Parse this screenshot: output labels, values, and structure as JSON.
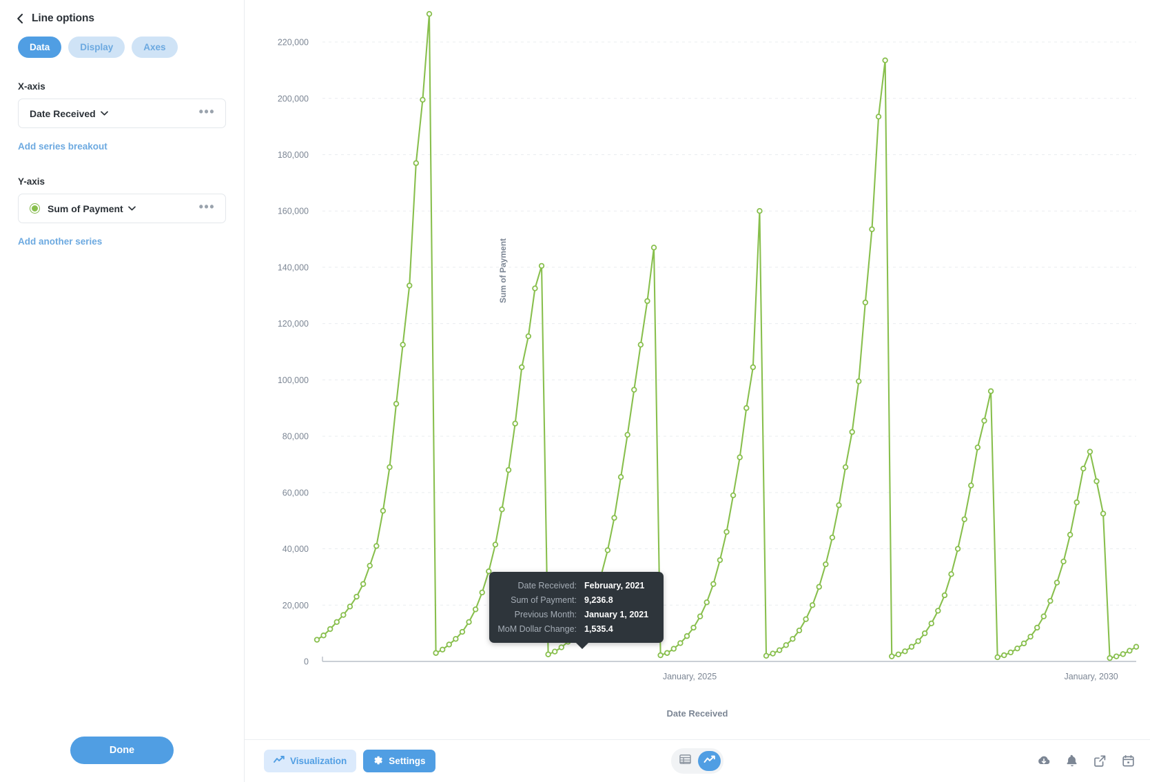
{
  "sidebar": {
    "back_icon": "chevron-left-icon",
    "title": "Line options",
    "tabs": [
      {
        "label": "Data",
        "active": true
      },
      {
        "label": "Display",
        "active": false
      },
      {
        "label": "Axes",
        "active": false
      }
    ],
    "x_axis": {
      "label": "X-axis",
      "value": "Date Received",
      "more_icon": "ellipsis-icon"
    },
    "add_series_breakout": "Add series breakout",
    "y_axis": {
      "label": "Y-axis",
      "value": "Sum of Payment",
      "series_color": "#88bf4d",
      "more_icon": "ellipsis-icon"
    },
    "add_another_series": "Add another series",
    "done_label": "Done"
  },
  "footer": {
    "visualization_label": "Visualization",
    "visualization_icon": "line-chart-icon",
    "settings_label": "Settings",
    "settings_icon": "gear-icon",
    "table_toggle_icon": "table-icon",
    "chart_toggle_icon": "line-chart-icon",
    "right_icons": [
      "download-icon",
      "bell-icon",
      "share-external-icon",
      "calendar-icon"
    ]
  },
  "tooltip": {
    "rows": [
      {
        "key": "Date Received:",
        "value": "February, 2021"
      },
      {
        "key": "Sum of Payment:",
        "value": "9,236.8"
      },
      {
        "key": "Previous Month:",
        "value": "January 1, 2021"
      },
      {
        "key": "MoM Dollar Change:",
        "value": "1,535.4"
      }
    ]
  },
  "chart_data": {
    "type": "line",
    "title": "",
    "xlabel": "Date Received",
    "ylabel": "Sum of Payment",
    "ylim": [
      0,
      232000
    ],
    "yticks": [
      0,
      20000,
      40000,
      60000,
      80000,
      100000,
      120000,
      140000,
      160000,
      180000,
      200000,
      220000
    ],
    "ytick_labels": [
      "0",
      "20,000",
      "40,000",
      "60,000",
      "80,000",
      "100,000",
      "120,000",
      "140,000",
      "160,000",
      "180,000",
      "200,000",
      "220,000"
    ],
    "xticks": [
      "January, 2025",
      "January, 2030"
    ],
    "xtick_positions": [
      0.455,
      0.945
    ],
    "grid": true,
    "legend": "none",
    "line_color": "#88bf4d",
    "marker": "circle-open",
    "series": [
      {
        "name": "Sum of Payment",
        "x": [
          "January, 2021",
          "February, 2021",
          "March, 2021",
          "April, 2021",
          "May, 2021",
          "June, 2021",
          "July, 2021",
          "August, 2021",
          "September, 2021",
          "October, 2021",
          "November, 2021",
          "December, 2021",
          "January, 2022",
          "February, 2022",
          "March, 2022",
          "April, 2022",
          "May, 2022",
          "June, 2022",
          "July, 2022",
          "August, 2022",
          "September, 2022",
          "October, 2022",
          "November, 2022",
          "December, 2022",
          "January, 2023",
          "February, 2023",
          "March, 2023",
          "April, 2023",
          "May, 2023",
          "June, 2023",
          "July, 2023",
          "August, 2023",
          "September, 2023",
          "October, 2023",
          "November, 2023",
          "December, 2023",
          "January, 2024",
          "February, 2024",
          "March, 2024",
          "April, 2024",
          "May, 2024",
          "June, 2024",
          "July, 2024",
          "August, 2024",
          "September, 2024",
          "October, 2024",
          "November, 2024",
          "December, 2024",
          "January, 2025",
          "February, 2025",
          "March, 2025",
          "April, 2025",
          "May, 2025",
          "June, 2025",
          "July, 2025",
          "August, 2025",
          "September, 2025",
          "October, 2025",
          "November, 2025",
          "December, 2025",
          "January, 2026",
          "February, 2026",
          "March, 2026",
          "April, 2026",
          "May, 2026",
          "June, 2026",
          "July, 2026",
          "August, 2026",
          "September, 2026",
          "October, 2026",
          "November, 2026",
          "December, 2026",
          "January, 2027",
          "February, 2027",
          "March, 2027",
          "April, 2027",
          "May, 2027",
          "June, 2027",
          "July, 2027",
          "August, 2027",
          "September, 2027",
          "October, 2027",
          "November, 2027",
          "December, 2027",
          "January, 2028",
          "February, 2028",
          "March, 2028",
          "April, 2028",
          "May, 2028",
          "June, 2028",
          "July, 2028",
          "August, 2028",
          "September, 2028",
          "October, 2028",
          "November, 2028",
          "December, 2028",
          "January, 2029",
          "February, 2029",
          "March, 2029",
          "April, 2029",
          "May, 2029",
          "June, 2029",
          "July, 2029",
          "August, 2029",
          "September, 2029",
          "October, 2029",
          "November, 2029",
          "December, 2029",
          "January, 2030",
          "February, 2030",
          "March, 2030",
          "April, 2030",
          "May, 2030",
          "June, 2030",
          "July, 2030",
          "August, 2030",
          "September, 2030",
          "October, 2030",
          "November, 2030",
          "December, 2030",
          "January, 2031",
          "February, 2031",
          "March, 2031",
          "April, 2031",
          "May, 2031"
        ],
        "values": [
          7701,
          9237,
          11500,
          14000,
          16500,
          19500,
          23000,
          27500,
          34000,
          41000,
          53500,
          69000,
          91500,
          112500,
          133500,
          177000,
          199500,
          230000,
          3000,
          4200,
          6000,
          8000,
          10500,
          14000,
          18500,
          24500,
          32000,
          41500,
          54000,
          68000,
          84500,
          104500,
          115500,
          132500,
          140500,
          2500,
          3500,
          5000,
          7000,
          9500,
          12500,
          17500,
          23500,
          30500,
          39500,
          51000,
          65500,
          80500,
          96500,
          112500,
          128000,
          147000,
          2200,
          3000,
          4500,
          6500,
          9000,
          12000,
          16000,
          21000,
          27500,
          36000,
          46000,
          59000,
          72500,
          90000,
          104500,
          160000,
          2000,
          2800,
          4000,
          5800,
          8000,
          11000,
          15000,
          20000,
          26500,
          34500,
          44000,
          55500,
          69000,
          81500,
          99500,
          127500,
          153500,
          193500,
          213500,
          1800,
          2500,
          3600,
          5200,
          7200,
          10000,
          13500,
          18000,
          23500,
          31000,
          40000,
          50500,
          62500,
          76000,
          85500,
          96000,
          1500,
          2200,
          3200,
          4600,
          6400,
          8800,
          12000,
          16000,
          21500,
          28000,
          35500,
          45000,
          56500,
          68500,
          74500,
          64000,
          52500,
          1200,
          1800,
          2600,
          3800,
          5200
        ]
      }
    ]
  }
}
